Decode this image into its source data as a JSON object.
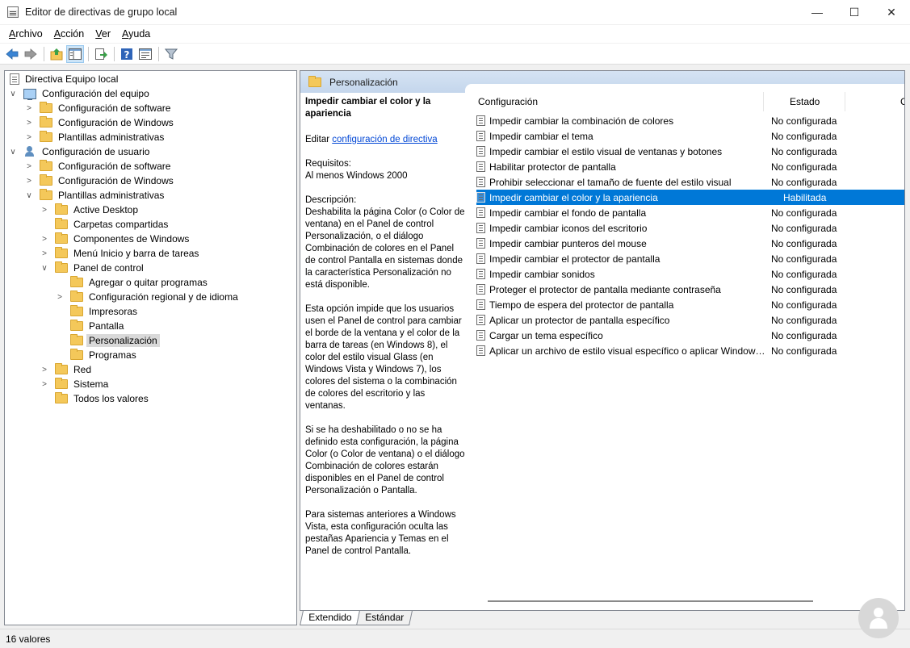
{
  "window": {
    "title": "Editor de directivas de grupo local",
    "minimize": "—",
    "maximize": "☐",
    "close": "✕"
  },
  "menu": [
    {
      "accel": "A",
      "rest": "rchivo"
    },
    {
      "accel": "A",
      "rest": "cción"
    },
    {
      "accel": "V",
      "rest": "er"
    },
    {
      "accel": "A",
      "rest": "yuda"
    }
  ],
  "toolbar_icons": [
    "back-arrow-icon",
    "forward-arrow-icon",
    "up-folder-icon",
    "show-hide-tree-icon",
    "export-list-icon",
    "help-icon",
    "properties-icon",
    "filter-icon"
  ],
  "tree": [
    {
      "label": "Directiva Equipo local"
    },
    {
      "label": "Configuración del equipo"
    },
    {
      "label": "Configuración de software"
    },
    {
      "label": "Configuración de Windows"
    },
    {
      "label": "Plantillas administrativas"
    },
    {
      "label": "Configuración de usuario"
    },
    {
      "label": "Configuración de software"
    },
    {
      "label": "Configuración de Windows"
    },
    {
      "label": "Plantillas administrativas"
    },
    {
      "label": "Active Desktop"
    },
    {
      "label": "Carpetas compartidas"
    },
    {
      "label": "Componentes de Windows"
    },
    {
      "label": "Menú Inicio y barra de tareas"
    },
    {
      "label": "Panel de control"
    },
    {
      "label": "Agregar o quitar programas"
    },
    {
      "label": "Configuración regional y de idioma"
    },
    {
      "label": "Impresoras"
    },
    {
      "label": "Pantalla"
    },
    {
      "label": "Personalización"
    },
    {
      "label": "Programas"
    },
    {
      "label": "Red"
    },
    {
      "label": "Sistema"
    },
    {
      "label": "Todos los valores"
    }
  ],
  "right_header": "Personalización",
  "description": {
    "title": "Impedir cambiar el color y la apariencia",
    "edit_prefix": "Editar ",
    "edit_link": "configuración de directiva",
    "req_label": "Requisitos:",
    "req_value": "Al menos Windows 2000",
    "desc_label": "Descripción:",
    "p1": "Deshabilita la página Color (o Color de ventana) en el Panel de control Personalización, o el diálogo Combinación de colores en el Panel de control Pantalla en sistemas donde la característica Personalización no está disponible.",
    "p2": "Esta opción impide que los usuarios usen el Panel de control para cambiar el borde de la ventana y el color de la barra de tareas (en Windows 8), el color del estilo visual Glass (en Windows Vista y Windows 7), los colores del sistema o la combinación de colores del escritorio y las ventanas.",
    "p3": "Si se ha deshabilitado o no se ha definido esta configuración, la página Color (o Color de ventana) o el diálogo Combinación de colores estarán disponibles en el Panel de control Personalización o Pantalla.",
    "p4": "Para sistemas anteriores a Windows Vista, esta configuración oculta las pestañas Apariencia y Temas en el Panel de control Pantalla."
  },
  "columns": {
    "setting": "Configuración",
    "state": "Estado",
    "comment": "C"
  },
  "settings": [
    {
      "name": "Impedir cambiar la combinación de colores",
      "state": "No configurada"
    },
    {
      "name": "Impedir cambiar el tema",
      "state": "No configurada"
    },
    {
      "name": "Impedir cambiar el estilo visual de ventanas y botones",
      "state": "No configurada"
    },
    {
      "name": "Habilitar protector de pantalla",
      "state": "No configurada"
    },
    {
      "name": "Prohibir seleccionar el tamaño de fuente del estilo visual",
      "state": "No configurada"
    },
    {
      "name": "Impedir cambiar el color y la apariencia",
      "state": "Habilitada"
    },
    {
      "name": "Impedir cambiar el fondo de pantalla",
      "state": "No configurada"
    },
    {
      "name": "Impedir cambiar iconos del escritorio",
      "state": "No configurada"
    },
    {
      "name": "Impedir cambiar punteros del mouse",
      "state": "No configurada"
    },
    {
      "name": "Impedir cambiar el protector de pantalla",
      "state": "No configurada"
    },
    {
      "name": "Impedir cambiar sonidos",
      "state": "No configurada"
    },
    {
      "name": "Proteger el protector de pantalla mediante contraseña",
      "state": "No configurada"
    },
    {
      "name": "Tiempo de espera del protector de pantalla",
      "state": "No configurada"
    },
    {
      "name": "Aplicar un protector de pantalla específico",
      "state": "No configurada"
    },
    {
      "name": "Cargar un tema específico",
      "state": "No configurada"
    },
    {
      "name": "Aplicar un archivo de estilo visual específico o aplicar Window…",
      "state": "No configurada"
    }
  ],
  "tabs": {
    "extended": "Extendido",
    "standard": "Estándar"
  },
  "status": "16 valores",
  "colors": {
    "selection": "#0078d7",
    "header_band": "#c4d6ec",
    "link": "#0046d5"
  }
}
